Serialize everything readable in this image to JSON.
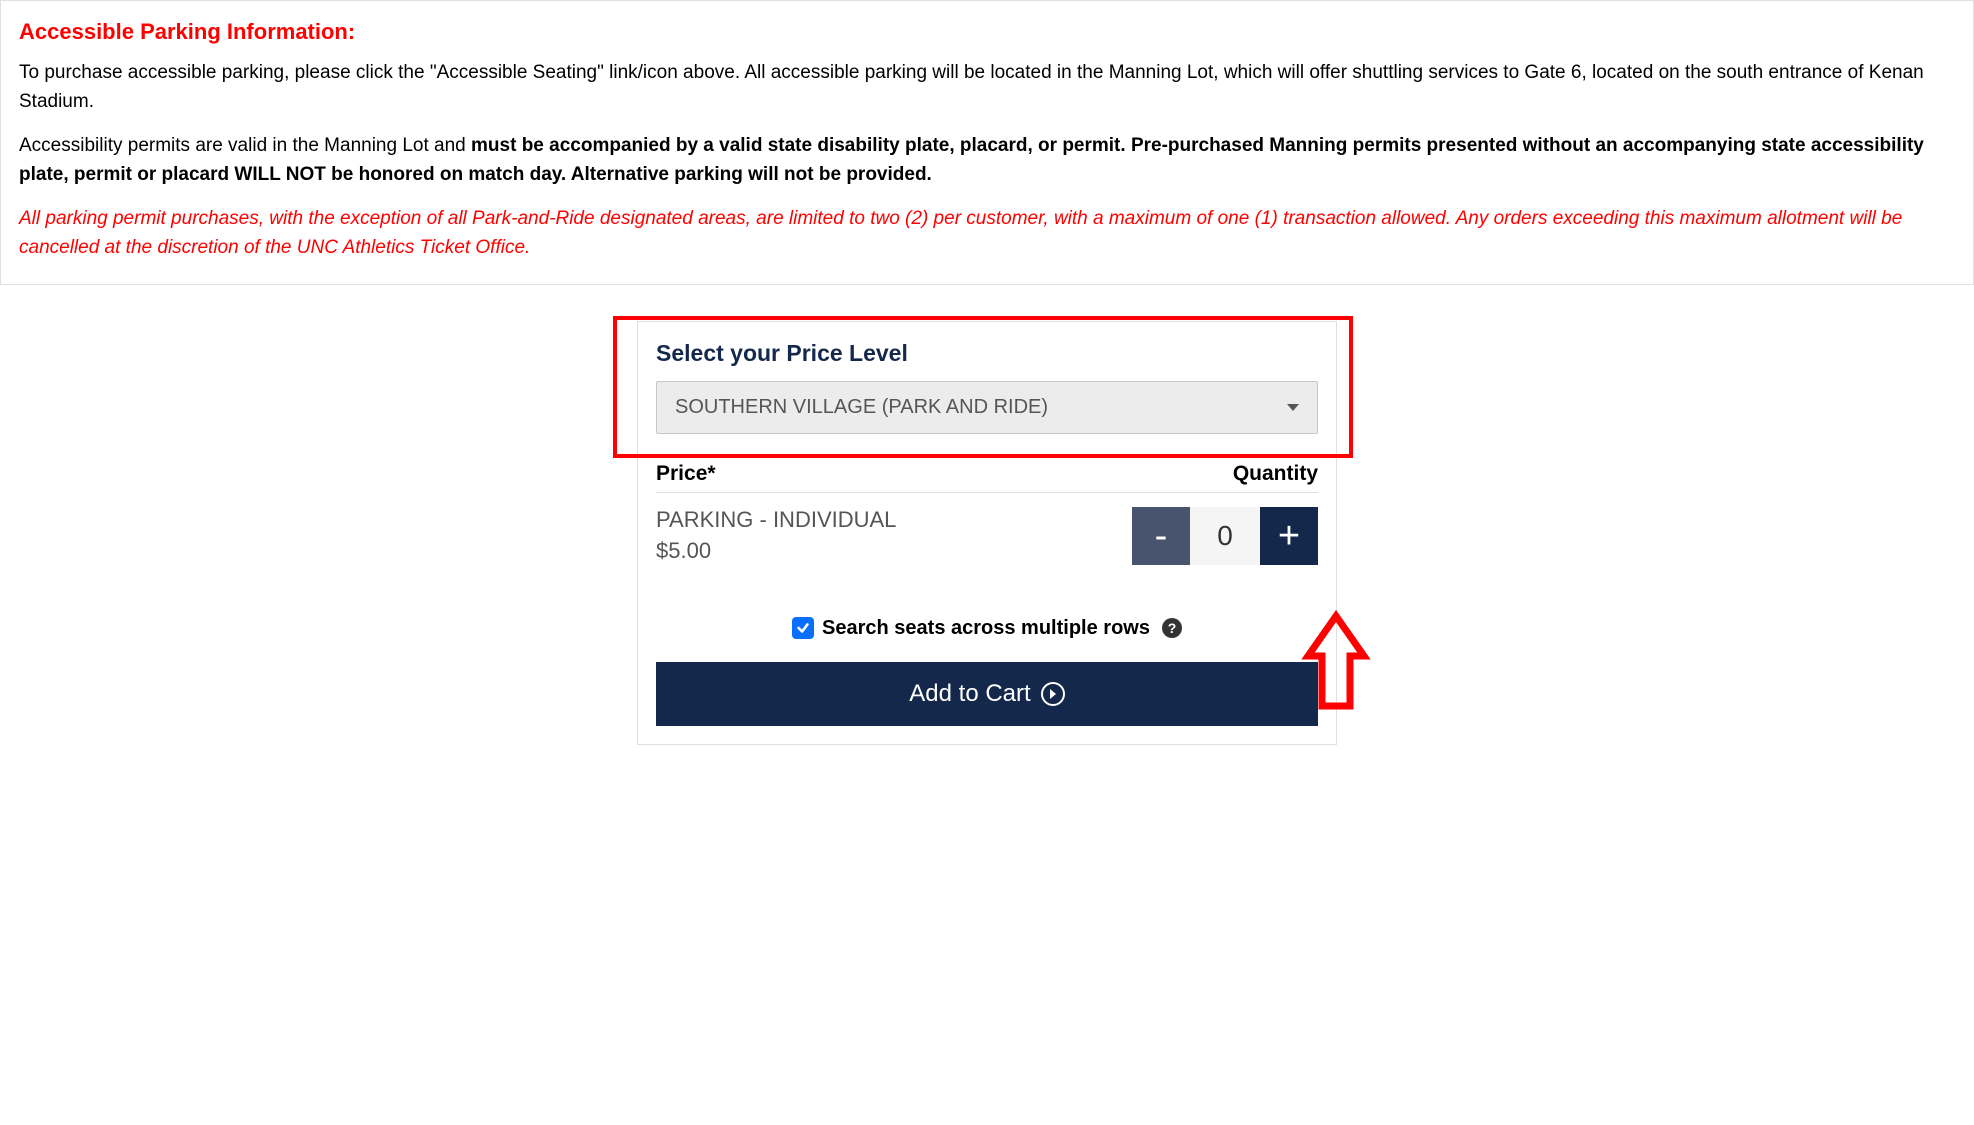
{
  "info": {
    "title": "Accessible Parking Information:",
    "p1": "To purchase accessible parking, please click the \"Accessible Seating\" link/icon above. All accessible parking will be located in the Manning Lot, which will offer shuttling services to Gate 6, located on the south entrance of Kenan Stadium.",
    "p2_prefix": "Accessibility permits are valid in the Manning Lot and ",
    "p2_bold": "must be accompanied by a valid state disability plate, placard, or permit. Pre-purchased Manning permits presented without an accompanying state accessibility plate, permit or placard WILL NOT be honored on match day. Alternative parking will not be provided.",
    "p3": "All parking permit purchases, with the exception of all Park-and-Ride designated areas, are limited to two (2) per customer, with a maximum of one (1) transaction allowed. Any orders exceeding this maximum allotment will be cancelled at the discretion of the UNC Athletics Ticket Office."
  },
  "selector": {
    "title": "Select your Price Level",
    "dropdown_value": "SOUTHERN VILLAGE (PARK AND RIDE)",
    "price_header_left": "Price*",
    "price_header_right": "Quantity",
    "item_name": "PARKING - INDIVIDUAL",
    "item_price": "$5.00",
    "quantity": "0",
    "minus": "-",
    "plus": "+",
    "checkbox_label": "Search seats across multiple rows",
    "help": "?",
    "add_cart": "Add to Cart"
  }
}
